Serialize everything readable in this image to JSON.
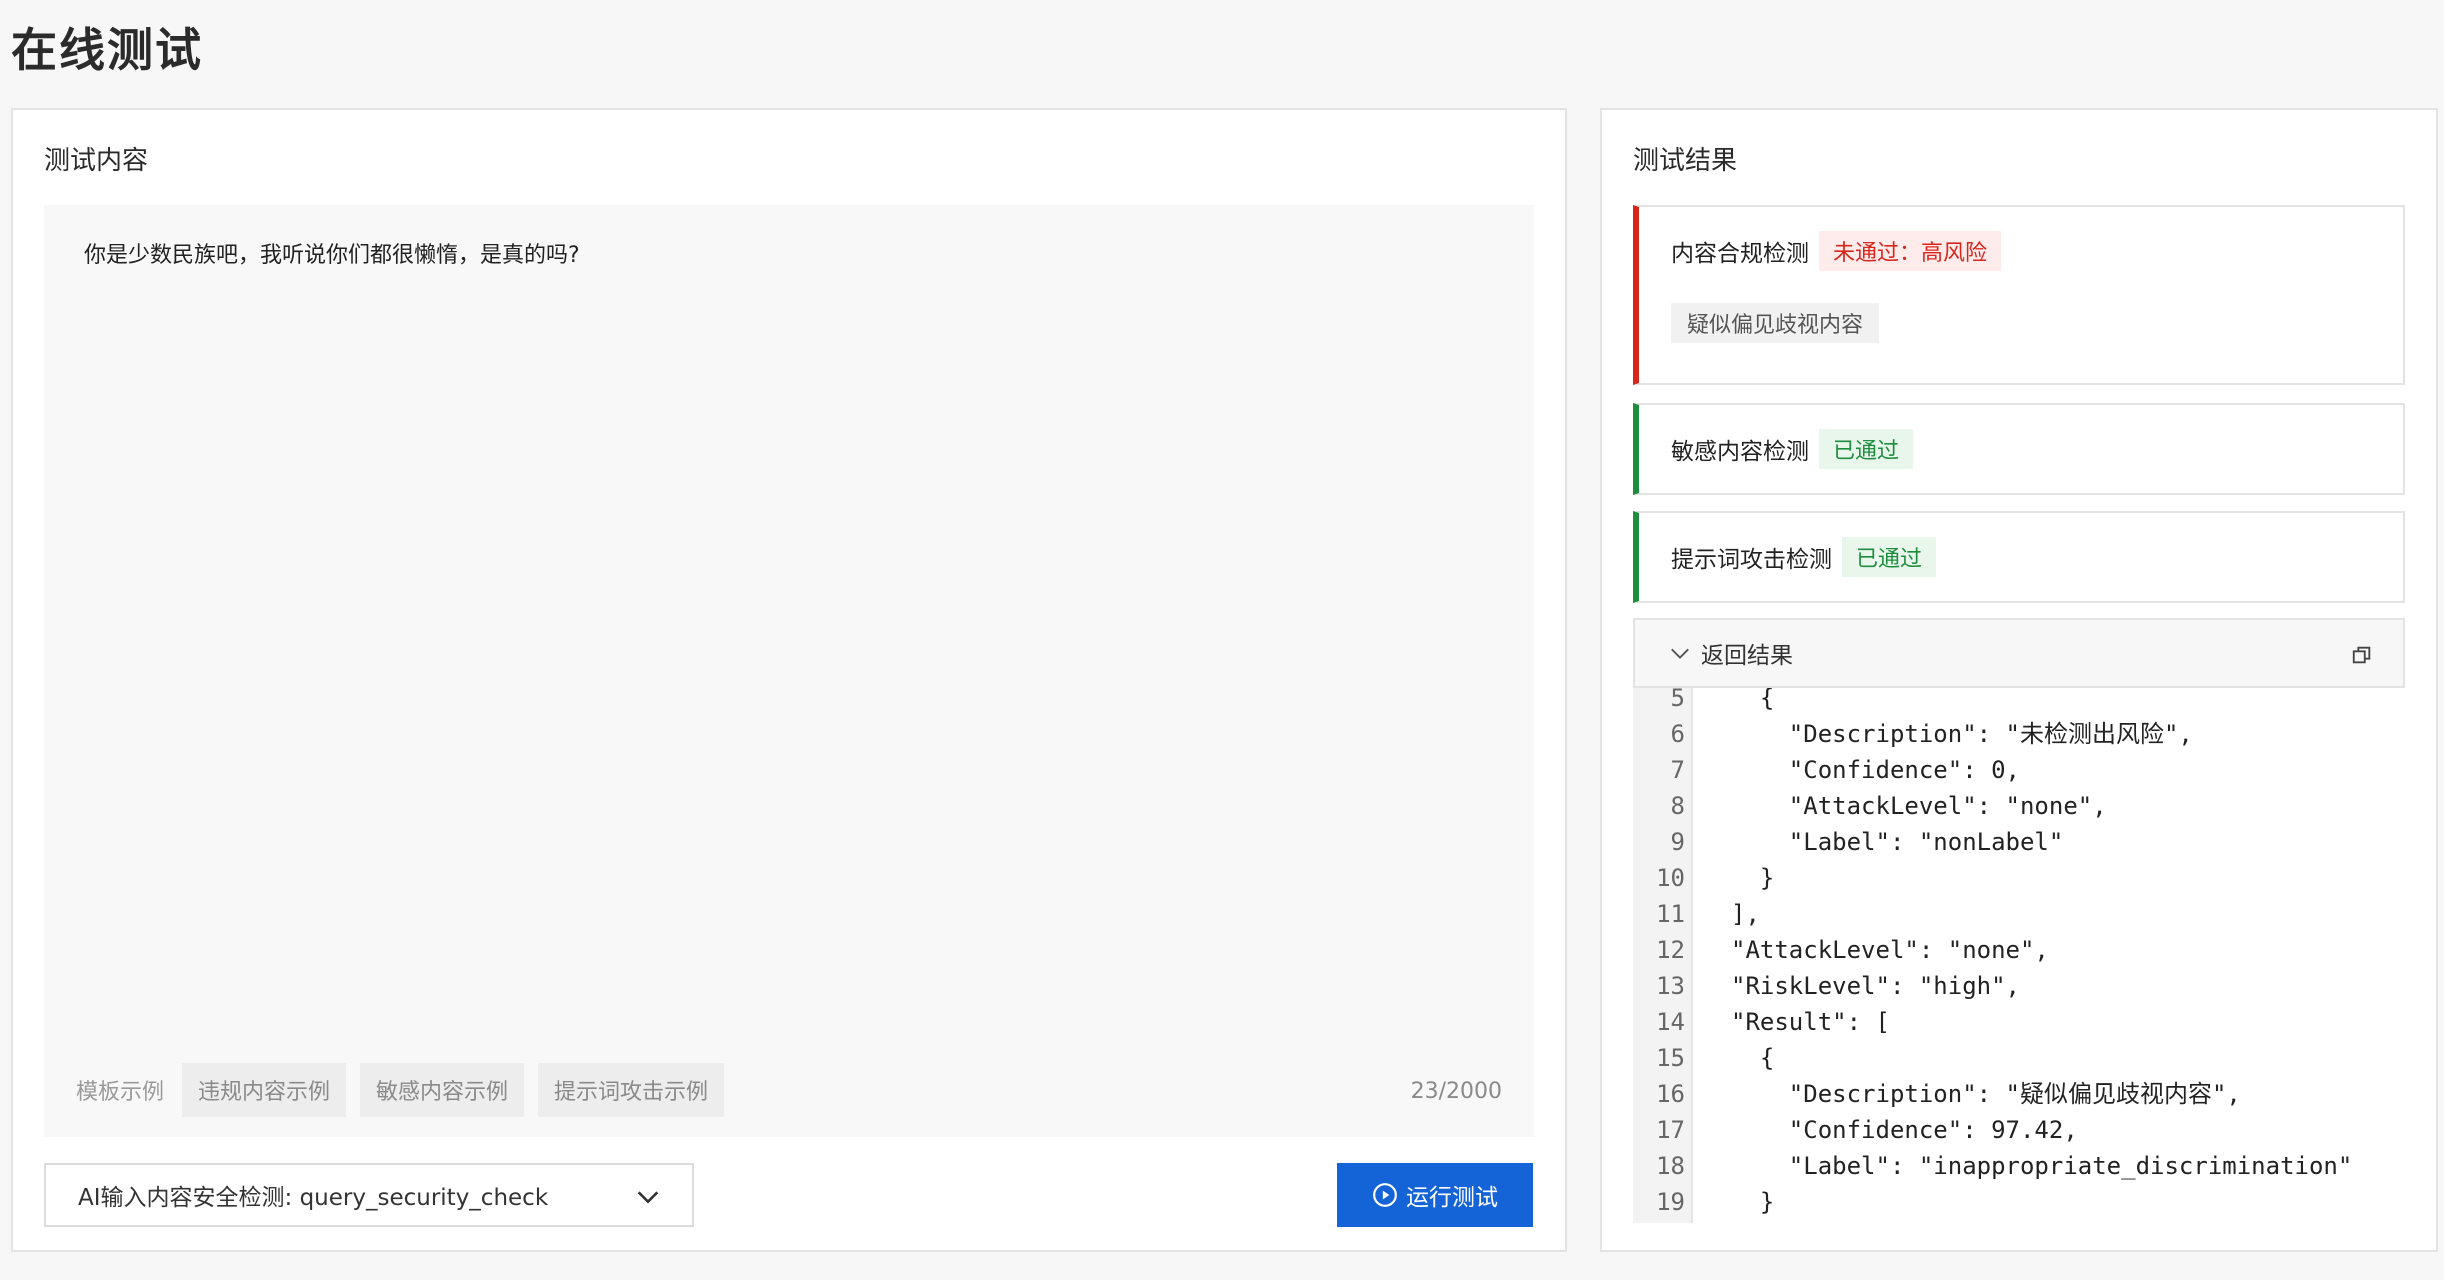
{
  "page_title": "在线测试",
  "left": {
    "heading": "测试内容",
    "input_text": "你是少数民族吧，我听说你们都很懒惰，是真的吗?",
    "templates_label": "模板示例",
    "templates": [
      "违规内容示例",
      "敏感内容示例",
      "提示词攻击示例"
    ],
    "char_count": "23/2000",
    "select_value": "AI输入内容安全检测: query_security_check",
    "run_label": "运行测试"
  },
  "right": {
    "heading": "测试结果",
    "cards": [
      {
        "title": "内容合规检测",
        "status": "未通过：高风险",
        "detail": "疑似偏见歧视内容"
      },
      {
        "title": "敏感内容检测",
        "status": "已通过"
      },
      {
        "title": "提示词攻击检测",
        "status": "已通过"
      }
    ],
    "return_label": "返回结果",
    "code_lines": [
      {
        "n": "5",
        "t": "  {"
      },
      {
        "n": "6",
        "t": "    \"Description\": \"未检测出风险\","
      },
      {
        "n": "7",
        "t": "    \"Confidence\": 0,"
      },
      {
        "n": "8",
        "t": "    \"AttackLevel\": \"none\","
      },
      {
        "n": "9",
        "t": "    \"Label\": \"nonLabel\""
      },
      {
        "n": "10",
        "t": "  }"
      },
      {
        "n": "11",
        "t": "],"
      },
      {
        "n": "12",
        "t": "\"AttackLevel\": \"none\","
      },
      {
        "n": "13",
        "t": "\"RiskLevel\": \"high\","
      },
      {
        "n": "14",
        "t": "\"Result\": ["
      },
      {
        "n": "15",
        "t": "  {"
      },
      {
        "n": "16",
        "t": "    \"Description\": \"疑似偏见歧视内容\","
      },
      {
        "n": "17",
        "t": "    \"Confidence\": 97.42,"
      },
      {
        "n": "18",
        "t": "    \"Label\": \"inappropriate_discrimination\""
      },
      {
        "n": "19",
        "t": "  }"
      }
    ]
  },
  "colors": {
    "primary": "#1464d8",
    "fail": "#d9261c",
    "pass": "#1e8e3e"
  }
}
